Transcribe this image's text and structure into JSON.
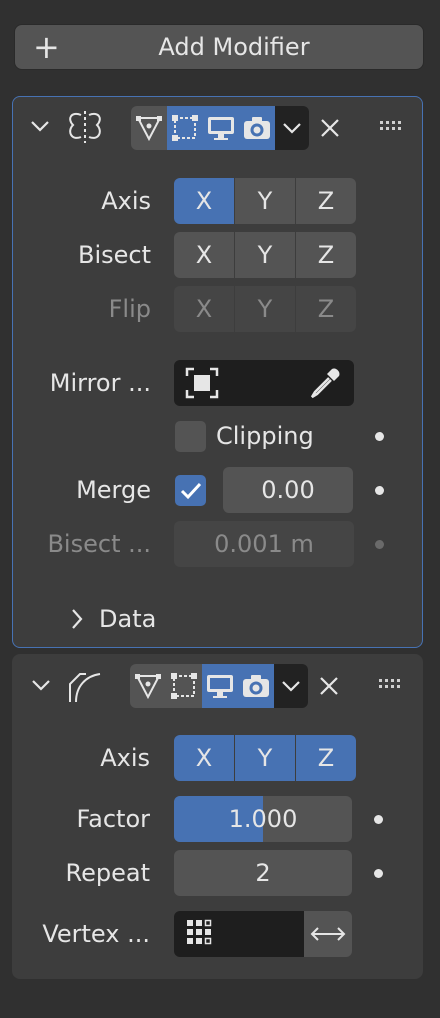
{
  "add_modifier": {
    "label": "Add Modifier"
  },
  "mirror": {
    "axis": {
      "label": "Axis",
      "x": "X",
      "y": "Y",
      "z": "Z"
    },
    "bisect": {
      "label": "Bisect",
      "x": "X",
      "y": "Y",
      "z": "Z"
    },
    "flip": {
      "label": "Flip",
      "x": "X",
      "y": "Y",
      "z": "Z"
    },
    "mirror_object": {
      "label": "Mirror ..."
    },
    "clipping": {
      "label": "Clipping"
    },
    "merge": {
      "label": "Merge",
      "value": "0.00"
    },
    "bisect_distance": {
      "label": "Bisect ...",
      "value": "0.001 m"
    },
    "data": {
      "label": "Data"
    }
  },
  "curve": {
    "axis": {
      "label": "Axis",
      "x": "X",
      "y": "Y",
      "z": "Z"
    },
    "factor": {
      "label": "Factor",
      "value": "1.000",
      "fill": 0.5
    },
    "repeat": {
      "label": "Repeat",
      "value": "2"
    },
    "vertex_group": {
      "label": "Vertex ..."
    }
  },
  "colors": {
    "accent": "#4772b3",
    "panel": "#3d3d3d",
    "button": "#545454",
    "bg": "#303030"
  }
}
